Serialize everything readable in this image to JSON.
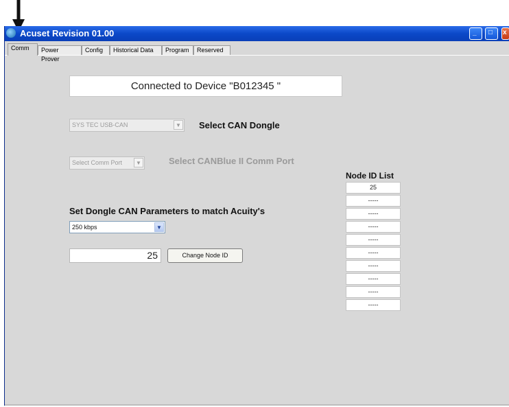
{
  "window": {
    "title": "Acuset Revision 01.00"
  },
  "tabs": [
    {
      "label": "Comm"
    },
    {
      "label": "Power Prover"
    },
    {
      "label": "Config"
    },
    {
      "label": "Historical Data"
    },
    {
      "label": "Program"
    },
    {
      "label": "Reserved"
    }
  ],
  "status": {
    "text": "Connected to Device \"B012345    \""
  },
  "dongle": {
    "value": "SYS TEC USB-CAN",
    "label": "Select CAN Dongle"
  },
  "comm_port": {
    "value": "Select Comm Port",
    "label": "Select CANBlue II Comm Port"
  },
  "can_params": {
    "label": "Set Dongle CAN Parameters to match Acuity's",
    "baud": "250 kbps"
  },
  "node_id": {
    "value": "25",
    "change_button": "Change Node ID"
  },
  "node_list": {
    "title": "Node ID List",
    "items": [
      "25",
      "-----",
      "-----",
      "-----",
      "-----",
      "-----",
      "-----",
      "-----",
      "-----",
      "-----"
    ]
  }
}
